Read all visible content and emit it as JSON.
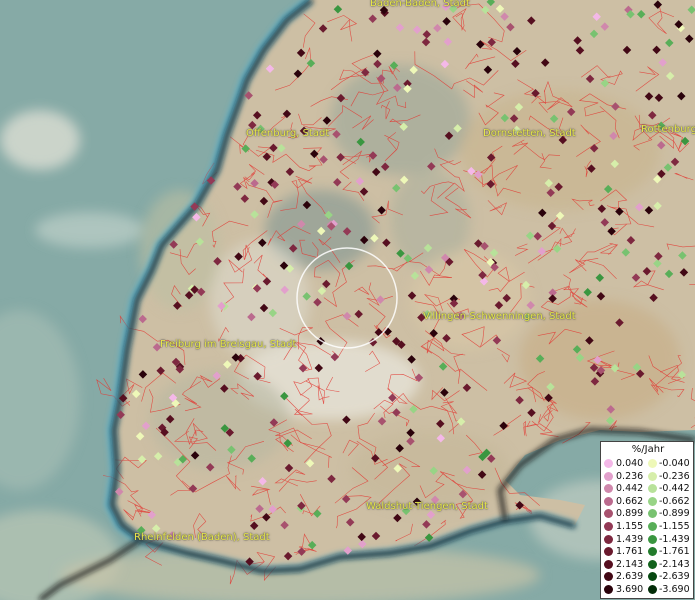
{
  "map": {
    "cities": [
      {
        "name": "Baden-Baden, Stadt"
      },
      {
        "name": "Offenburg, Stadt"
      },
      {
        "name": "Dornstetten, Stadt"
      },
      {
        "name": "Rottenburg"
      },
      {
        "name": "Villingen-Schwenningen, Stadt"
      },
      {
        "name": "Freiburg im Breisgau, Stadt"
      },
      {
        "name": "Waldshut-Tiengen, Stadt"
      },
      {
        "name": "Rheinfelden (Baden), Stadt"
      }
    ]
  },
  "legend": {
    "title": "%/Jahr",
    "positive": [
      {
        "label": "0.040",
        "color": "#f4b8e8"
      },
      {
        "label": "0.236",
        "color": "#e2a0cc"
      },
      {
        "label": "0.442",
        "color": "#d088ac"
      },
      {
        "label": "0.662",
        "color": "#bb6a8e"
      },
      {
        "label": "0.899",
        "color": "#a8526f"
      },
      {
        "label": "1.155",
        "color": "#933a56"
      },
      {
        "label": "1.439",
        "color": "#7e2840"
      },
      {
        "label": "1.761",
        "color": "#6a1a2e"
      },
      {
        "label": "2.143",
        "color": "#560f20"
      },
      {
        "label": "2.639",
        "color": "#420815"
      },
      {
        "label": "3.690",
        "color": "#2a020b"
      }
    ],
    "negative": [
      {
        "label": "-0.040",
        "color": "#eef8b8"
      },
      {
        "label": "-0.236",
        "color": "#d6eeaa"
      },
      {
        "label": "-0.442",
        "color": "#b8e29a"
      },
      {
        "label": "-0.662",
        "color": "#98d486"
      },
      {
        "label": "-0.899",
        "color": "#78c270"
      },
      {
        "label": "-1.155",
        "color": "#58ae58"
      },
      {
        "label": "-1.439",
        "color": "#3a9640"
      },
      {
        "label": "-1.761",
        "color": "#237c2c"
      },
      {
        "label": "-2.143",
        "color": "#12621c"
      },
      {
        "label": "-2.639",
        "color": "#064810"
      },
      {
        "label": "-3.690",
        "color": "#022c08"
      }
    ]
  }
}
